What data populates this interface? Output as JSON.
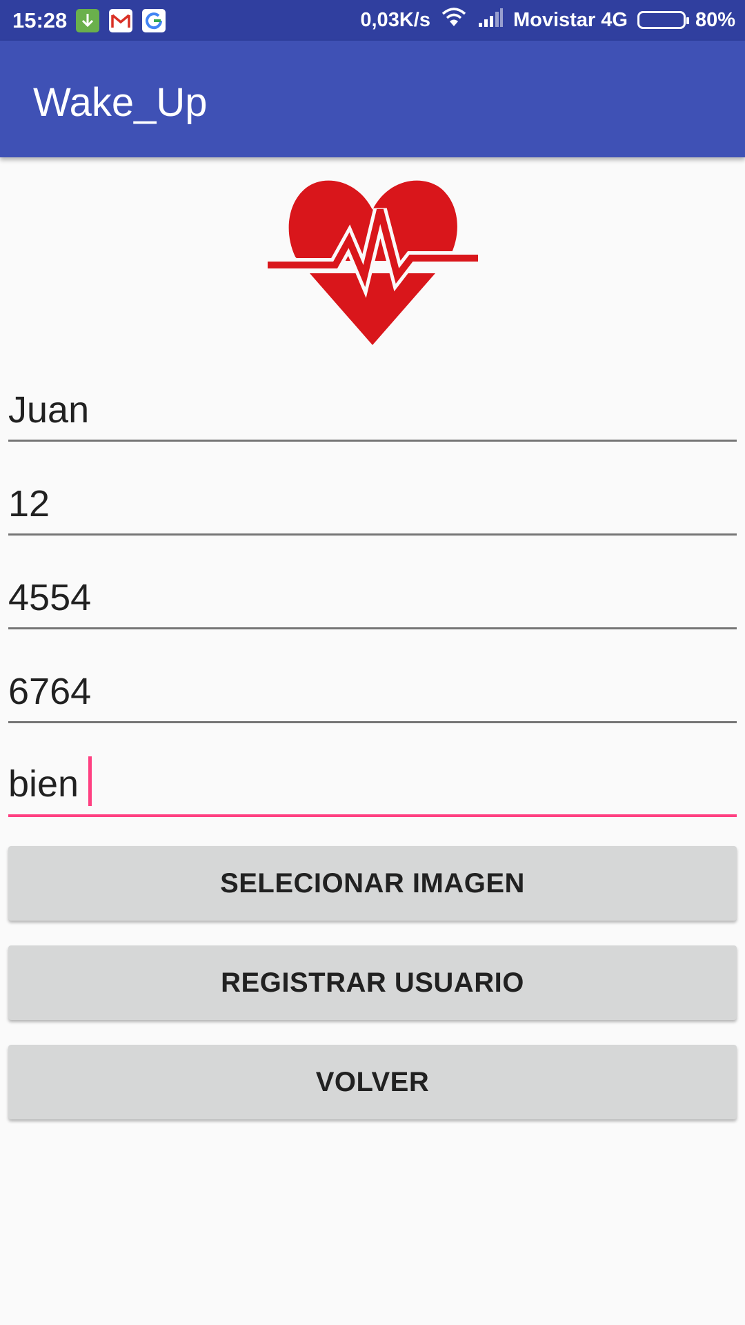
{
  "status_bar": {
    "time": "15:28",
    "net_speed": "0,03K/s",
    "carrier": "Movistar 4G",
    "battery_percent": "80%",
    "battery_level": 0.8,
    "notification_icons": [
      "download-icon",
      "gmail-icon",
      "google-icon"
    ]
  },
  "app_bar": {
    "title": "Wake_Up"
  },
  "form": {
    "fields": [
      {
        "value": "Juan"
      },
      {
        "value": "12"
      },
      {
        "value": "4554"
      },
      {
        "value": "6764"
      },
      {
        "value": "bien"
      }
    ]
  },
  "buttons": {
    "select_image": "SELECIONAR IMAGEN",
    "register_user": "REGISTRAR USUARIO",
    "back": "VOLVER"
  },
  "colors": {
    "status_bar": "#303f9f",
    "app_bar": "#3f51b5",
    "accent": "#ff4081",
    "heart": "#d9161b",
    "button": "#d6d7d7"
  }
}
